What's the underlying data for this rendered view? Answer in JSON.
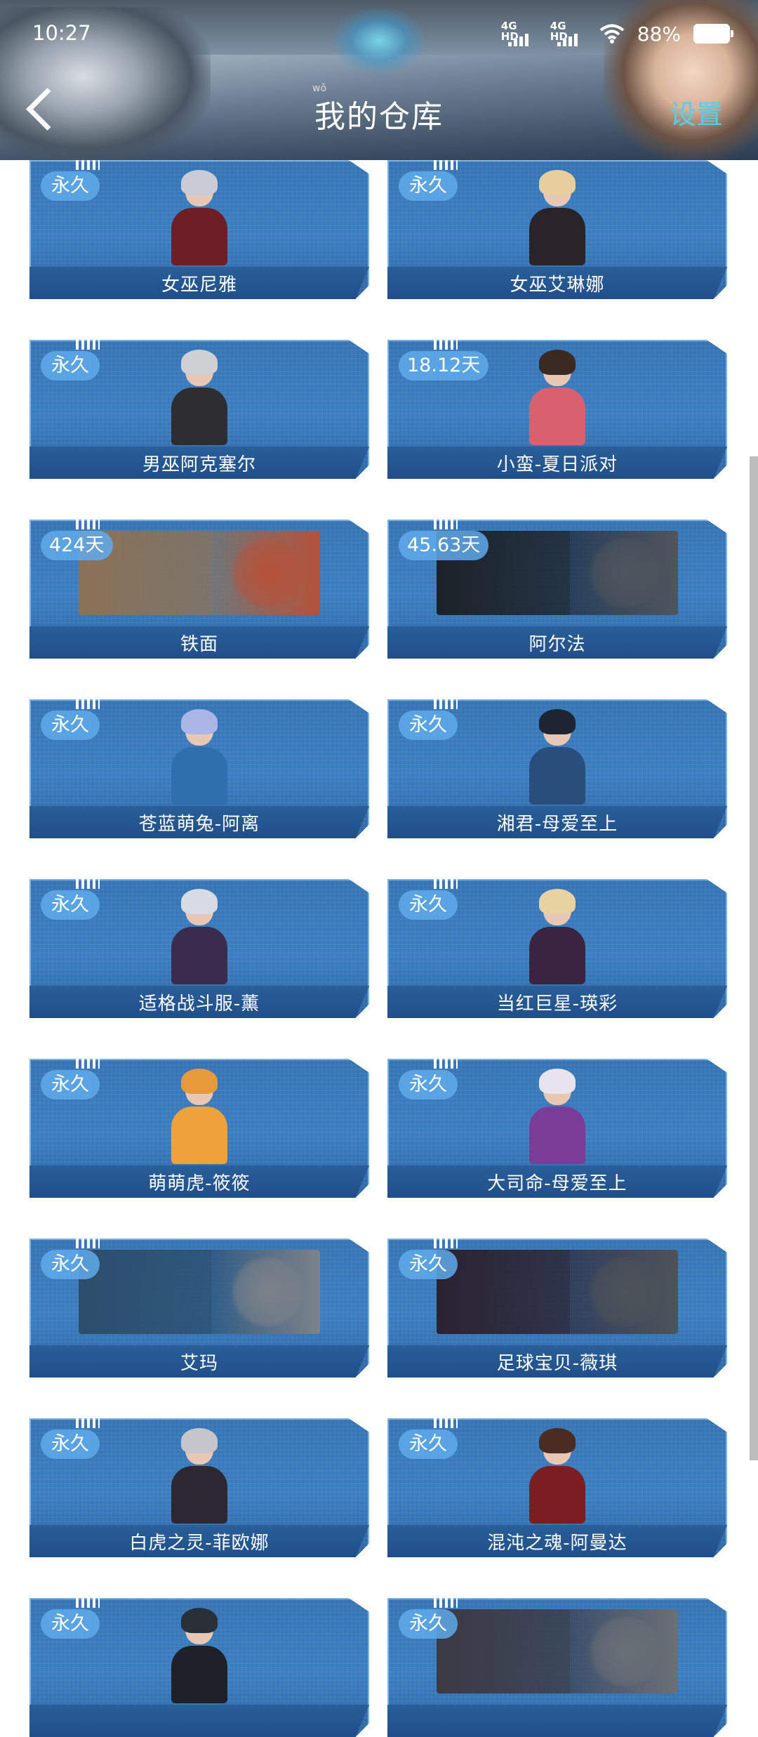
{
  "status_bar": {
    "time": "10:27",
    "network1": "4G HD",
    "network2": "4G HD",
    "battery": "88%"
  },
  "header": {
    "title": "我的仓库",
    "title_ruby": "wǒ",
    "settings_label": "设置"
  },
  "items": [
    {
      "name": "女巫尼雅",
      "duration": "永久",
      "style": "portrait",
      "hair": "#c9ccd6",
      "body": "#6e1e26"
    },
    {
      "name": "女巫艾琳娜",
      "duration": "永久",
      "style": "portrait",
      "hair": "#e6cf9c",
      "body": "#2a2428"
    },
    {
      "name": "男巫阿克塞尔",
      "duration": "永久",
      "style": "portrait",
      "hair": "#cfd0d2",
      "body": "#2e2d30"
    },
    {
      "name": "小蛮-夏日派对",
      "duration": "18.12天",
      "style": "portrait",
      "hair": "#3b2a22",
      "body": "#d9606e"
    },
    {
      "name": "铁面",
      "duration": "424天",
      "style": "banner",
      "left": "#8c7256",
      "right": "#b5523a"
    },
    {
      "name": "阿尔法",
      "duration": "45.63天",
      "style": "banner",
      "left": "#1d2228",
      "right": "#50555d"
    },
    {
      "name": "苍蓝萌兔-阿离",
      "duration": "永久",
      "style": "portrait",
      "hair": "#a9b6e6",
      "body": "#2f6fae"
    },
    {
      "name": "湘君-母爱至上",
      "duration": "永久",
      "style": "portrait",
      "hair": "#1e2430",
      "body": "#2a4e7c"
    },
    {
      "name": "适格战斗服-薰",
      "duration": "永久",
      "style": "portrait",
      "hair": "#d7dbe6",
      "body": "#3a2c4e"
    },
    {
      "name": "当红巨星-瑛彩",
      "duration": "永久",
      "style": "portrait",
      "hair": "#e8d2a2",
      "body": "#3a2440"
    },
    {
      "name": "萌萌虎-筱筱",
      "duration": "永久",
      "style": "portrait",
      "hair": "#e69a3c",
      "body": "#f0a23a"
    },
    {
      "name": "大司命-母爱至上",
      "duration": "永久",
      "style": "portrait",
      "hair": "#e9e3ee",
      "body": "#7b3c98"
    },
    {
      "name": "艾玛",
      "duration": "永久",
      "style": "banner",
      "left": "#2c4e6c",
      "right": "#7d8288"
    },
    {
      "name": "足球宝贝-薇琪",
      "duration": "永久",
      "style": "banner",
      "left": "#2b2230",
      "right": "#4e5358"
    },
    {
      "name": "白虎之灵-菲欧娜",
      "duration": "永久",
      "style": "portrait",
      "hair": "#c5c6cc",
      "body": "#2c2730"
    },
    {
      "name": "混沌之魂-阿曼达",
      "duration": "永久",
      "style": "portrait",
      "hair": "#4a2c22",
      "body": "#7a1e22"
    },
    {
      "name": "",
      "duration": "永久",
      "style": "portrait",
      "hair": "#2a3038",
      "body": "#1e2228"
    },
    {
      "name": "",
      "duration": "永久",
      "style": "banner",
      "left": "#3c3a44",
      "right": "#6c7076"
    }
  ]
}
